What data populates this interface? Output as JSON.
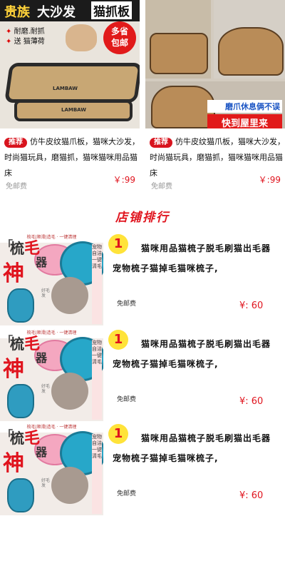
{
  "products": [
    {
      "image": {
        "banner_1": "贵族",
        "banner_2": "大沙发",
        "banner_3": "猫抓板",
        "features": [
          "耐磨.耐抓",
          "送 猫薄荷"
        ],
        "badge_line_1": "多省",
        "badge_line_2": "包邮",
        "brand_1": "LAMBAW",
        "brand_2": "LAMBAW"
      },
      "tag": "推荐",
      "title": "仿牛皮纹猫爪板，猫咪大沙发，时尚猫玩具，磨猫抓，猫咪猫咪用品猫床",
      "price": "￥:99",
      "shipping": "免邮费"
    },
    {
      "image": {
        "overlay_1": "磨爪休息俩不误",
        "overlay_2": "快到屋里来"
      },
      "tag": "推荐",
      "title": "仿牛皮纹猫爪板，猫咪大沙发，时尚猫玩具，磨猫抓，猫咪猫咪用品猫床",
      "price": "￥:99",
      "shipping": "免邮费"
    }
  ],
  "ranking": {
    "title": "店铺排行",
    "items": [
      {
        "rank": "1",
        "title": "猫咪用品猫梳子脱毛刷猫出毛器宠物梳子猫掉毛猫咪梳子,",
        "shipping": "免邮费",
        "price": "¥: 60",
        "image": {
          "header": "梳毛|顺滑|造毛 · 一键清理",
          "big_1": "梳",
          "big_2": "毛",
          "big_3": "器",
          "big_4": "神",
          "side": "好毛发",
          "vert": "宠物自洁 一键清毛",
          "bracket": "「"
        }
      },
      {
        "rank": "1",
        "title": "猫咪用品猫梳子脱毛刷猫出毛器宠物梳子猫掉毛猫咪梳子,",
        "shipping": "免邮费",
        "price": "¥: 60",
        "image": {
          "header": "梳毛|顺滑|造毛 · 一键清理",
          "big_1": "梳",
          "big_2": "毛",
          "big_3": "器",
          "big_4": "神",
          "side": "好毛发",
          "vert": "宠物自洁 一键清毛",
          "bracket": "「"
        }
      },
      {
        "rank": "1",
        "title": "猫咪用品猫梳子脱毛刷猫出毛器宠物梳子猫掉毛猫咪梳子,",
        "shipping": "免邮费",
        "price": "¥: 60",
        "image": {
          "header": "梳毛|顺滑|造毛 · 一键清理",
          "big_1": "梳",
          "big_2": "毛",
          "big_3": "器",
          "big_4": "神",
          "side": "好毛发",
          "vert": "宠物自洁 一键清毛",
          "bracket": "「"
        }
      }
    ]
  },
  "colors": {
    "accent": "#e0141e",
    "badge_yellow": "#ffe33a"
  }
}
